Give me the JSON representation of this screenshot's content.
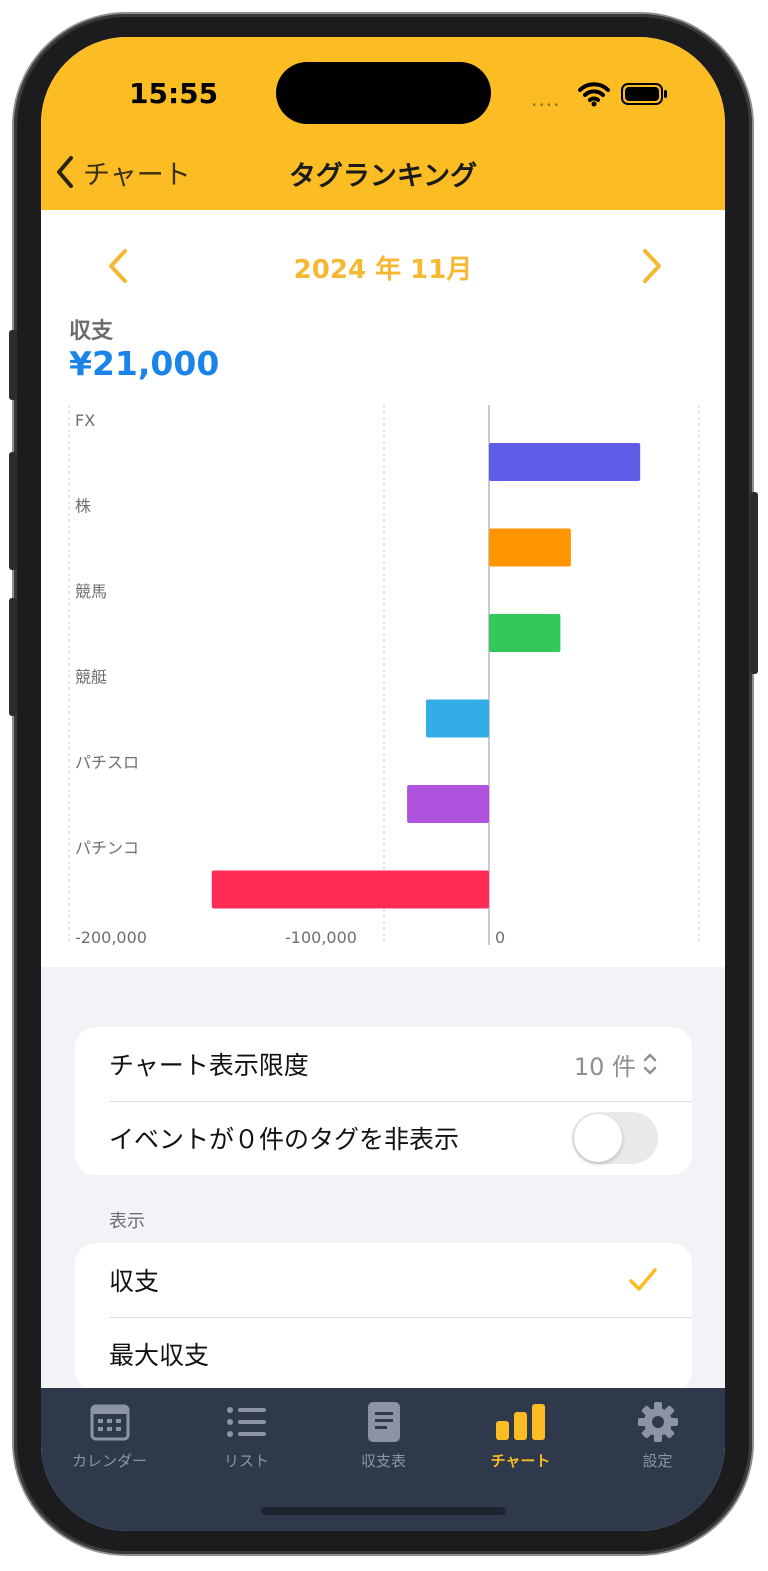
{
  "status_bar": {
    "time": "15:55",
    "signal": "...."
  },
  "nav": {
    "back_label": "チャート",
    "title": "タグランキング"
  },
  "period": {
    "label": "2024 年 11月"
  },
  "summary": {
    "label": "収支",
    "value": "¥21,000",
    "value_color": "#1a84ea"
  },
  "colors": {
    "accent": "#fbbc24",
    "tab_bar": "#2e3a4b"
  },
  "chart_data": {
    "type": "bar",
    "orientation": "horizontal",
    "categories": [
      "FX",
      "株",
      "競馬",
      "競艇",
      "パチスロ",
      "パチンコ"
    ],
    "values": [
      72000,
      39000,
      34000,
      -30000,
      -39000,
      -132000
    ],
    "colors": [
      "#5e5ce6",
      "#ff9500",
      "#34c759",
      "#32ade6",
      "#af52de",
      "#ff2d55"
    ],
    "x_ticks": [
      -200000,
      -100000,
      0
    ],
    "x_tick_labels": [
      "-200,000",
      "-100,000",
      "0"
    ],
    "xlim": [
      -200000,
      100000
    ],
    "grid": true
  },
  "settings": {
    "limit_label": "チャート表示限度",
    "limit_value": "10 件",
    "hide_empty_label": "イベントが０件のタグを非表示",
    "hide_empty_on": false,
    "display_header": "表示",
    "display_options": [
      {
        "label": "収支",
        "selected": true
      },
      {
        "label": "最大収支",
        "selected": false
      }
    ]
  },
  "tabs": [
    {
      "label": "カレンダー",
      "icon": "calendar-icon",
      "active": false
    },
    {
      "label": "リスト",
      "icon": "list-icon",
      "active": false
    },
    {
      "label": "収支表",
      "icon": "document-icon",
      "active": false
    },
    {
      "label": "チャート",
      "icon": "bar-chart-icon",
      "active": true
    },
    {
      "label": "設定",
      "icon": "gear-icon",
      "active": false
    }
  ]
}
